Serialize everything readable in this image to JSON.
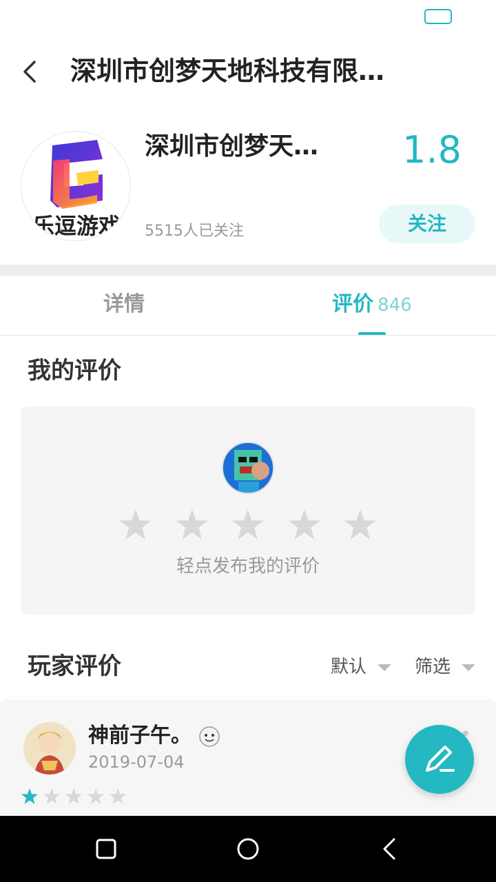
{
  "header": {
    "title": "深圳市创梦天地科技有限…"
  },
  "developer": {
    "name": "深圳市创梦天…",
    "rating": "1.8",
    "followers": "5515人已关注",
    "follow_label": "关注",
    "logo_text": "乐逗游戏"
  },
  "tabs": {
    "details_label": "详情",
    "reviews_label": "评价",
    "reviews_count": "846"
  },
  "my_review": {
    "title": "我的评价",
    "hint": "轻点发布我的评价",
    "stars_total": 5
  },
  "player_reviews": {
    "title": "玩家评价",
    "sort_label": "默认",
    "filter_label": "筛选"
  },
  "reviews": [
    {
      "name": "神前子午。",
      "date": "2019-07-04",
      "rating": 1,
      "max_rating": 5
    }
  ],
  "colors": {
    "accent": "#23b8c2",
    "star_empty": "#d8d8d8"
  }
}
